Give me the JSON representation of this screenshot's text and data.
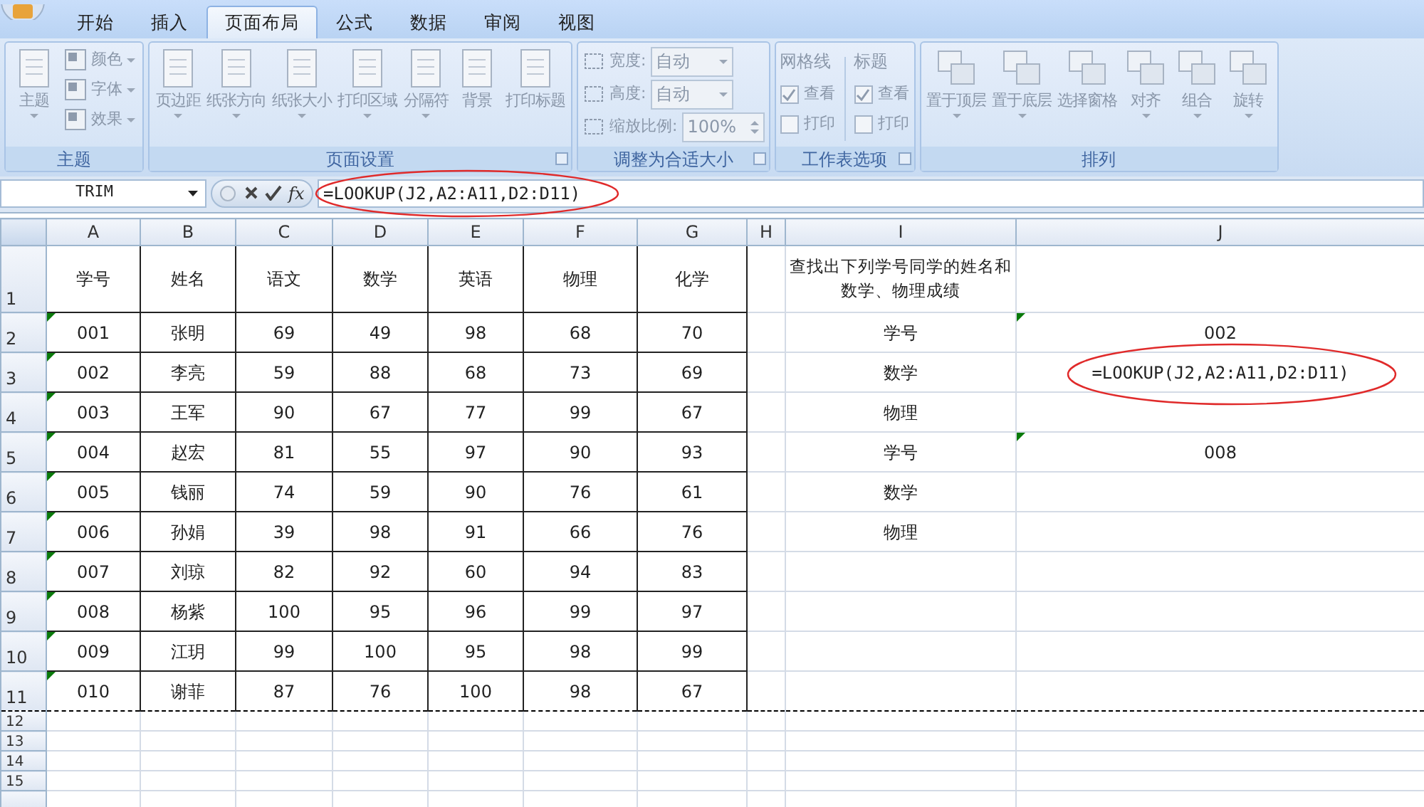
{
  "tabs": [
    {
      "label": "开始",
      "selected": false
    },
    {
      "label": "插入",
      "selected": false
    },
    {
      "label": "页面布局",
      "selected": true
    },
    {
      "label": "公式",
      "selected": false
    },
    {
      "label": "数据",
      "selected": false
    },
    {
      "label": "审阅",
      "selected": false
    },
    {
      "label": "视图",
      "selected": false
    }
  ],
  "ribbon": {
    "disabled": true,
    "groups": [
      {
        "title": "主题",
        "launcher": false,
        "controls": [
          {
            "kind": "large",
            "label": "主题",
            "caret": true
          },
          {
            "kind": "small",
            "label": "颜色",
            "caret": true
          },
          {
            "kind": "small",
            "label": "字体",
            "caret": true
          },
          {
            "kind": "small",
            "label": "效果",
            "caret": true
          }
        ]
      },
      {
        "title": "页面设置",
        "launcher": true,
        "controls": [
          {
            "kind": "large",
            "label": "页边距",
            "caret": true
          },
          {
            "kind": "large",
            "label": "纸张方向",
            "caret": true
          },
          {
            "kind": "large",
            "label": "纸张大小",
            "caret": true
          },
          {
            "kind": "large",
            "label": "打印区域",
            "caret": true
          },
          {
            "kind": "large",
            "label": "分隔符",
            "caret": true
          },
          {
            "kind": "large",
            "label": "背景",
            "caret": false
          },
          {
            "kind": "large",
            "label": "打印标题",
            "caret": false
          }
        ]
      },
      {
        "title": "调整为合适大小",
        "launcher": true,
        "controls": [
          {
            "kind": "dropdown",
            "label": "宽度:",
            "value": "自动"
          },
          {
            "kind": "dropdown",
            "label": "高度:",
            "value": "自动"
          },
          {
            "kind": "spin",
            "label": "缩放比例:",
            "value": "100%"
          }
        ]
      },
      {
        "title": "工作表选项",
        "launcher": true,
        "controls": [
          {
            "kind": "column",
            "heading": "网格线",
            "options": [
              {
                "label": "查看",
                "checked": true
              },
              {
                "label": "打印",
                "checked": false
              }
            ]
          },
          {
            "kind": "column",
            "heading": "标题",
            "options": [
              {
                "label": "查看",
                "checked": true
              },
              {
                "label": "打印",
                "checked": false
              }
            ]
          }
        ]
      },
      {
        "title": "排列",
        "launcher": false,
        "controls": [
          {
            "kind": "large",
            "label": "置于顶层",
            "caret": true
          },
          {
            "kind": "large",
            "label": "置于底层",
            "caret": true
          },
          {
            "kind": "large",
            "label": "选择窗格",
            "caret": false
          },
          {
            "kind": "large",
            "label": "对齐",
            "caret": true
          },
          {
            "kind": "large",
            "label": "组合",
            "caret": true
          },
          {
            "kind": "large",
            "label": "旋转",
            "caret": true
          }
        ]
      }
    ]
  },
  "formula_bar": {
    "name_box": "TRIM",
    "function_label": "fx",
    "formula": "=LOOKUP(J2,A2:A11,D2:D11)"
  },
  "sheet": {
    "columns": [
      "A",
      "B",
      "C",
      "D",
      "E",
      "F",
      "G",
      "H",
      "I",
      "J"
    ],
    "rows": [
      {
        "number": "1",
        "table": [
          "学号",
          "姓名",
          "语文",
          "数学",
          "英语",
          "物理",
          "化学"
        ],
        "flagged": false,
        "side_label": "查找出下列学号同学的姓名和数学、物理成绩"
      },
      {
        "number": "2",
        "table": [
          "001",
          "张明",
          "69",
          "49",
          "98",
          "68",
          "70"
        ],
        "flagged": true,
        "side_label": "学号",
        "side_value": "002",
        "value_flagged": true,
        "editing": false
      },
      {
        "number": "3",
        "table": [
          "002",
          "李亮",
          "59",
          "88",
          "68",
          "73",
          "69"
        ],
        "flagged": true,
        "side_label": "数学",
        "side_value": "=LOOKUP(J2,A2:A11,D2:D11)",
        "value_flagged": false,
        "editing": true
      },
      {
        "number": "4",
        "table": [
          "003",
          "王军",
          "90",
          "67",
          "77",
          "99",
          "67"
        ],
        "flagged": true,
        "side_label": "物理"
      },
      {
        "number": "5",
        "table": [
          "004",
          "赵宏",
          "81",
          "55",
          "97",
          "90",
          "93"
        ],
        "flagged": true,
        "side_label": "学号",
        "side_value": "008",
        "value_flagged": true,
        "editing": false
      },
      {
        "number": "6",
        "table": [
          "005",
          "钱丽",
          "74",
          "59",
          "90",
          "76",
          "61"
        ],
        "flagged": true,
        "side_label": "数学"
      },
      {
        "number": "7",
        "table": [
          "006",
          "孙娟",
          "39",
          "98",
          "91",
          "66",
          "76"
        ],
        "flagged": true,
        "side_label": "物理"
      },
      {
        "number": "8",
        "table": [
          "007",
          "刘琼",
          "82",
          "92",
          "60",
          "94",
          "83"
        ],
        "flagged": true
      },
      {
        "number": "9",
        "table": [
          "008",
          "杨紫",
          "100",
          "95",
          "96",
          "99",
          "97"
        ],
        "flagged": true
      },
      {
        "number": "10",
        "table": [
          "009",
          "江玥",
          "99",
          "100",
          "95",
          "98",
          "99"
        ],
        "flagged": true
      },
      {
        "number": "11",
        "table": [
          "010",
          "谢菲",
          "87",
          "76",
          "100",
          "98",
          "67"
        ],
        "flagged": true,
        "page_break": true
      },
      {
        "number": "12"
      },
      {
        "number": "13"
      },
      {
        "number": "14"
      },
      {
        "number": "15"
      }
    ]
  }
}
